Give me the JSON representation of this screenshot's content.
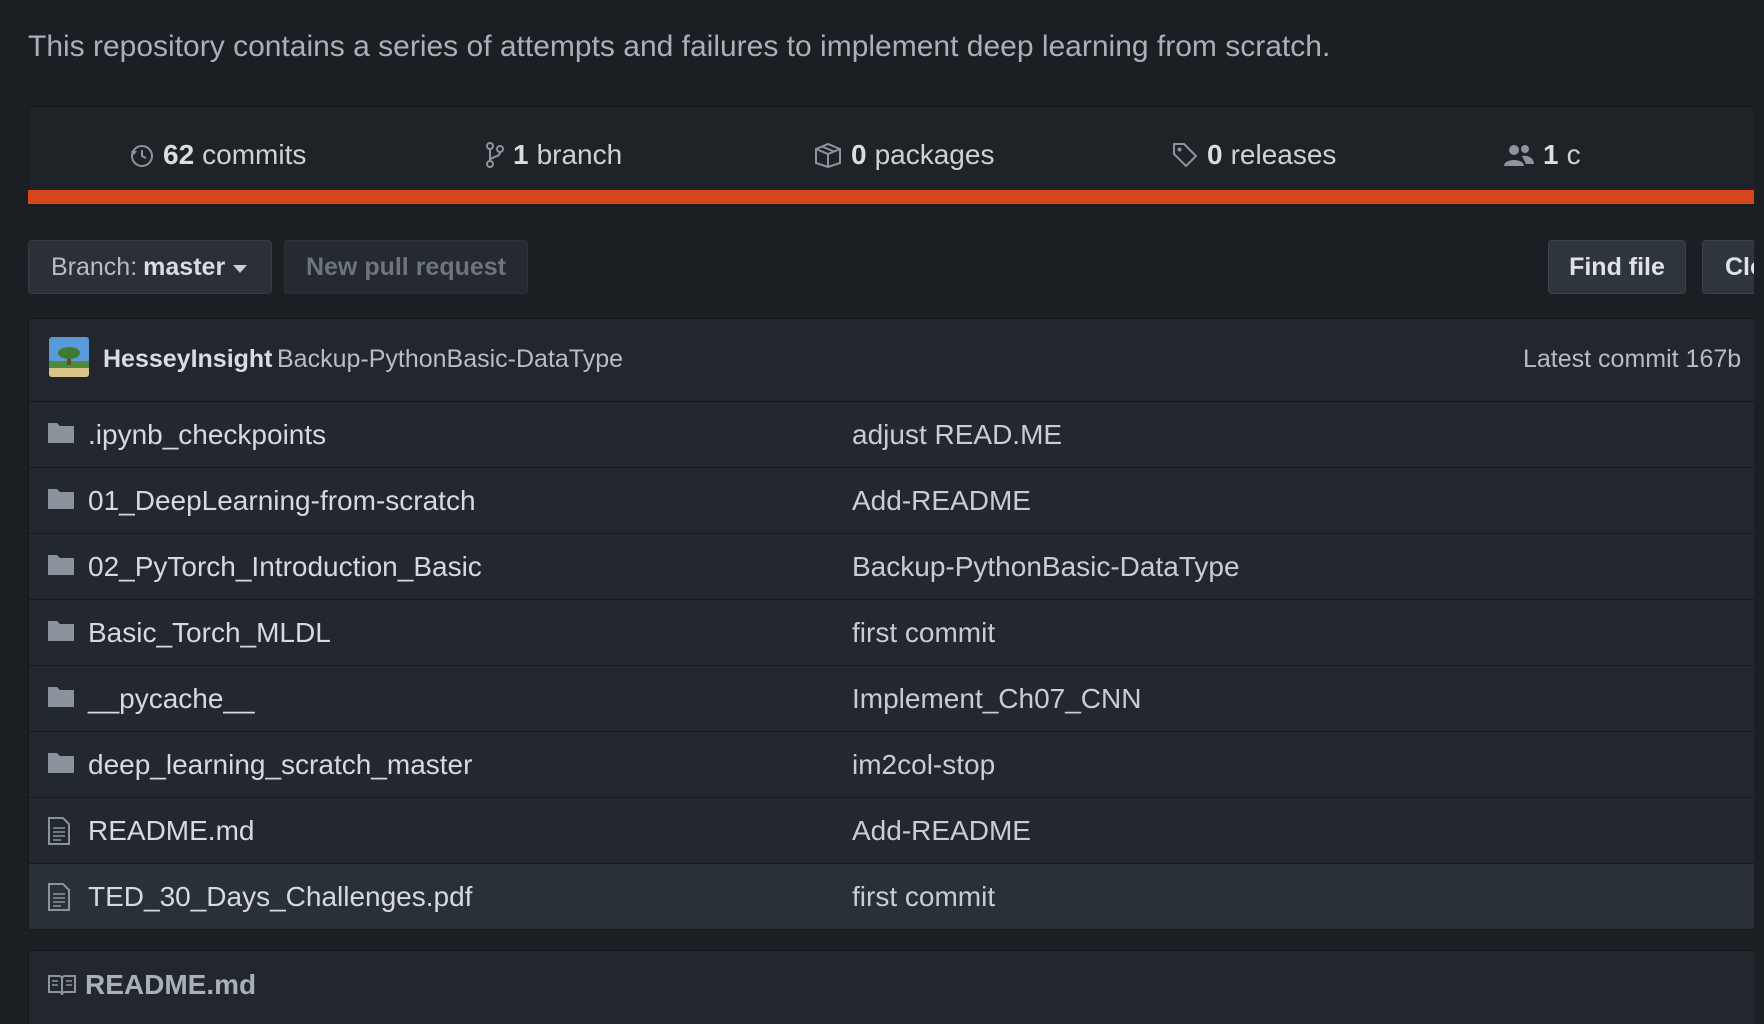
{
  "repo": {
    "description": "This repository contains a series of attempts and failures to implement deep learning from scratch."
  },
  "summary": {
    "commits": {
      "num": "62",
      "label": "commits",
      "icon": "history-icon"
    },
    "branches": {
      "num": "1",
      "label": "branch",
      "icon": "branch-icon"
    },
    "packages": {
      "num": "0",
      "label": "packages",
      "icon": "package-icon"
    },
    "releases": {
      "num": "0",
      "label": "releases",
      "icon": "tag-icon"
    },
    "contributors": {
      "num": "1",
      "label": "c",
      "icon": "people-icon"
    }
  },
  "language_bar_color": "#d6461c",
  "toolbar": {
    "branch_prefix": "Branch:",
    "branch_name": "master",
    "new_pr_label": "New pull request",
    "find_file_label": "Find file",
    "clone_label": "Clo"
  },
  "latest_commit": {
    "author": "HesseyInsight",
    "message": "Backup-PythonBasic-DataType",
    "right_text": "Latest commit 167b"
  },
  "files": [
    {
      "type": "dir",
      "name": ".ipynb_checkpoints",
      "message": "adjust READ.ME"
    },
    {
      "type": "dir",
      "name": "01_DeepLearning-from-scratch",
      "message": "Add-README"
    },
    {
      "type": "dir",
      "name": "02_PyTorch_Introduction_Basic",
      "message": "Backup-PythonBasic-DataType"
    },
    {
      "type": "dir",
      "name": "Basic_Torch_MLDL",
      "message": "first commit"
    },
    {
      "type": "dir",
      "name": "__pycache__",
      "message": "Implement_Ch07_CNN"
    },
    {
      "type": "dir",
      "name": "deep_learning_scratch_master",
      "message": "im2col-stop"
    },
    {
      "type": "file",
      "name": "README.md",
      "message": "Add-README"
    },
    {
      "type": "file",
      "name": "TED_30_Days_Challenges.pdf",
      "message": "first commit"
    }
  ],
  "readme": {
    "title": "README.md",
    "icon": "book-icon"
  }
}
